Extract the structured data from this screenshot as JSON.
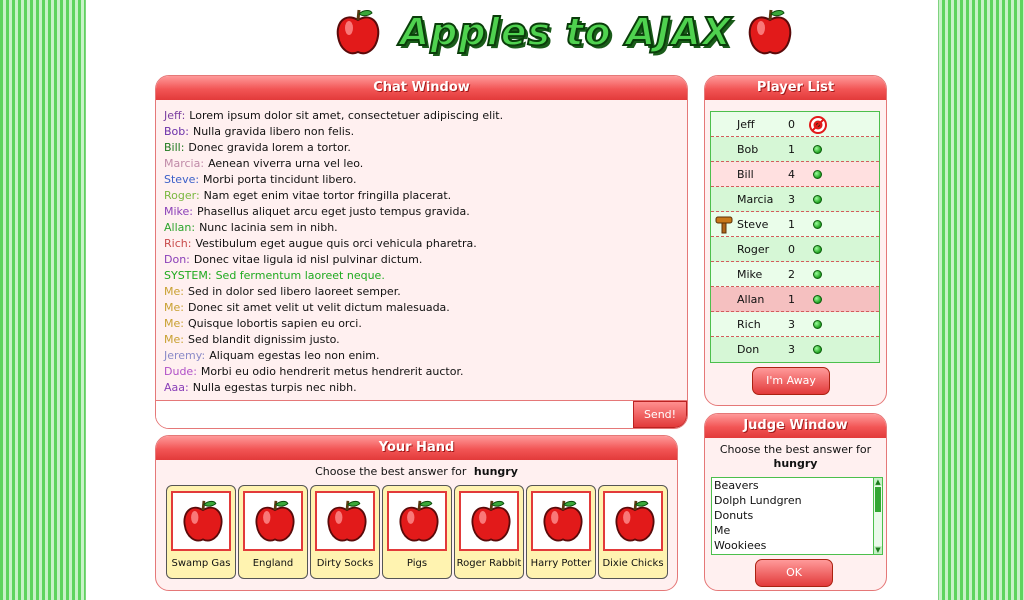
{
  "header": {
    "title": "Apples to AJAX"
  },
  "chat": {
    "title": "Chat Window",
    "messages": [
      {
        "sender": "Jeff:",
        "text": "Lorem ipsum dolor sit amet, consectetuer adipiscing elit.",
        "color": "#7b3fa0"
      },
      {
        "sender": "Bob:",
        "text": "Nulla gravida libero non felis.",
        "color": "#6a2fa8"
      },
      {
        "sender": "Bill:",
        "text": "Donec gravida lorem a tortor.",
        "color": "#1f7a1f"
      },
      {
        "sender": "Marcia:",
        "text": "Aenean viverra urna vel leo.",
        "color": "#c08aa8"
      },
      {
        "sender": "Steve:",
        "text": "Morbi porta tincidunt libero.",
        "color": "#3a5fc8"
      },
      {
        "sender": "Roger:",
        "text": "Nam eget enim vitae tortor fringilla placerat.",
        "color": "#7ab840"
      },
      {
        "sender": "Mike:",
        "text": "Phasellus aliquet arcu eget justo tempus gravida.",
        "color": "#8a3fb8"
      },
      {
        "sender": "Allan:",
        "text": "Nunc lacinia sem in nibh.",
        "color": "#2ea52e"
      },
      {
        "sender": "Rich:",
        "text": "Vestibulum eget augue quis orci vehicula pharetra.",
        "color": "#c84a4a"
      },
      {
        "sender": "Don:",
        "text": "Donec vitae ligula id nisl pulvinar dictum.",
        "color": "#8a3fb8"
      },
      {
        "sender": "SYSTEM:",
        "text": "Sed fermentum laoreet neque.",
        "color": "#1faa1f",
        "system": true
      },
      {
        "sender": "Me:",
        "text": "Sed in dolor sed libero laoreet semper.",
        "color": "#c8a030"
      },
      {
        "sender": "Me:",
        "text": "Donec sit amet velit ut velit dictum malesuada.",
        "color": "#c8a030"
      },
      {
        "sender": "Me:",
        "text": "Quisque lobortis sapien eu orci.",
        "color": "#c8a030"
      },
      {
        "sender": "Me:",
        "text": "Sed blandit dignissim justo.",
        "color": "#c8a030"
      },
      {
        "sender": "Jeremy:",
        "text": "Aliquam egestas leo non enim.",
        "color": "#8a8ac8"
      },
      {
        "sender": "Dude:",
        "text": "Morbi eu odio hendrerit metus hendrerit auctor.",
        "color": "#b050c8"
      },
      {
        "sender": "Aaa:",
        "text": "Nulla egestas turpis nec nibh.",
        "color": "#8a3fb8"
      }
    ],
    "input_value": "",
    "send_label": "Send!"
  },
  "hand": {
    "title": "Your Hand",
    "prompt": "Choose the best answer for",
    "word": "hungry",
    "cards": [
      "Swamp Gas",
      "England",
      "Dirty Socks",
      "Pigs",
      "Roger Rabbit",
      "Harry Potter",
      "Dixie Chicks"
    ]
  },
  "players": {
    "title": "Player List",
    "rows": [
      {
        "name": "Jeff",
        "score": "0",
        "status": "target-icon",
        "bg": "light"
      },
      {
        "name": "Bob",
        "score": "1",
        "status": "online-dot",
        "bg": "mid"
      },
      {
        "name": "Bill",
        "score": "4",
        "status": "online-dot",
        "bg": "pink"
      },
      {
        "name": "Marcia",
        "score": "3",
        "status": "online-dot",
        "bg": "mid"
      },
      {
        "name": "Steve",
        "score": "1",
        "status": "online-dot",
        "bg": "light",
        "judge": true
      },
      {
        "name": "Roger",
        "score": "0",
        "status": "online-dot",
        "bg": "mid"
      },
      {
        "name": "Mike",
        "score": "2",
        "status": "online-dot",
        "bg": "light"
      },
      {
        "name": "Allan",
        "score": "1",
        "status": "online-dot",
        "bg": "rose"
      },
      {
        "name": "Rich",
        "score": "3",
        "status": "online-dot",
        "bg": "light"
      },
      {
        "name": "Don",
        "score": "3",
        "status": "online-dot",
        "bg": "mid"
      }
    ],
    "away_label": "I'm Away"
  },
  "judge": {
    "title": "Judge Window",
    "prompt": "Choose the best answer for",
    "word": "hungry",
    "options": [
      "Beavers",
      "Dolph Lundgren",
      "Donuts",
      "Me",
      "Wookiees"
    ],
    "ok_label": "OK"
  },
  "colors": {
    "panel_header": "#e23a3a",
    "panel_bg": "#fff0f0",
    "card_bg": "#fff3b0",
    "stripe_green": "#5ed45e"
  }
}
